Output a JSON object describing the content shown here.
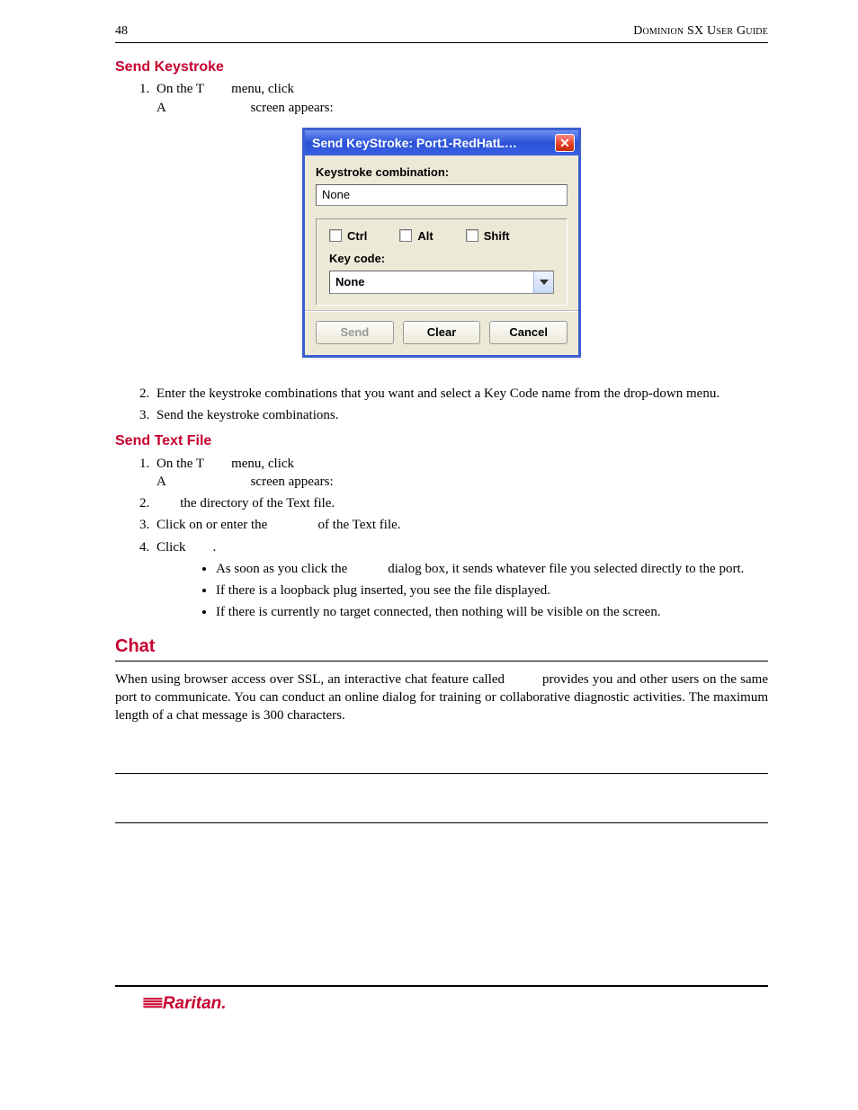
{
  "header": {
    "page_number": "48",
    "doc_title": "Dominion SX User Guide"
  },
  "section1": {
    "heading": "Send Keystroke",
    "step1_a": "On the T",
    "step1_b": "menu, click",
    "step1_c": "A",
    "step1_d": "screen appears:",
    "step2": "Enter the keystroke combinations that you want and select a Key Code name from the drop-down menu.",
    "step3": "Send the keystroke combinations."
  },
  "dialog": {
    "title": "Send KeyStroke: Port1-RedHatL…",
    "combo_label": "Keystroke combination:",
    "combo_value": "None",
    "ctrl": "Ctrl",
    "alt": "Alt",
    "shift": "Shift",
    "keycode_label": "Key code:",
    "keycode_value": "None",
    "send": "Send",
    "clear": "Clear",
    "cancel": "Cancel"
  },
  "section2": {
    "heading": "Send Text File",
    "step1_a": "On the T",
    "step1_b": "menu, click",
    "step1_c": "A",
    "step1_d": "screen appears:",
    "step2": "the directory of the Text file.",
    "step3_a": "Click on or enter the",
    "step3_b": "of the Text file.",
    "step4": "Click",
    "step4_dot": ".",
    "b1_a": "As soon as you click the",
    "b1_b": "dialog box, it sends whatever file you selected directly to the port.",
    "b2": "If there is a loopback plug inserted, you see the file displayed.",
    "b3": "If there is currently no target connected, then nothing will be visible on the screen."
  },
  "chat": {
    "heading": "Chat",
    "body_a": "When using browser access over SSL, an interactive chat feature called",
    "body_b": "provides you and other users on the same port to communicate. You can conduct an online dialog for training or collaborative diagnostic activities. The maximum length of a chat message is 300 characters."
  },
  "footer": {
    "brand": "Raritan.",
    "glyph": "≣≣"
  }
}
